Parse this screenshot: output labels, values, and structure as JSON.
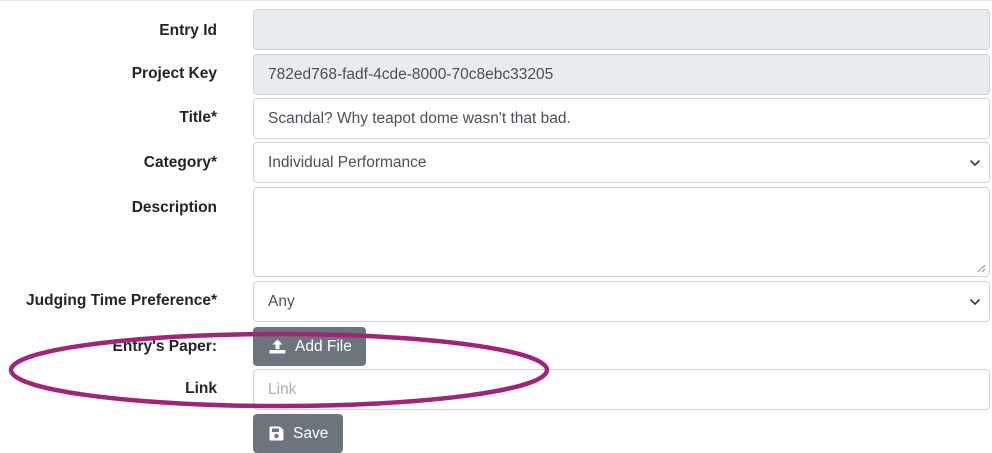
{
  "form": {
    "entry_id": {
      "label": "Entry Id",
      "value": ""
    },
    "project_key": {
      "label": "Project Key",
      "value": "782ed768-fadf-4cde-8000-70c8ebc33205"
    },
    "title": {
      "label": "Title*",
      "value": "Scandal? Why teapot dome wasn't that bad."
    },
    "category": {
      "label": "Category*",
      "selected": "Individual Performance"
    },
    "description": {
      "label": "Description",
      "value": ""
    },
    "judging_time": {
      "label": "Judging Time Preference*",
      "selected": "Any"
    },
    "entry_paper": {
      "label": "Entry's Paper:",
      "button_label": "Add File"
    },
    "link": {
      "label": "Link",
      "placeholder": "Link",
      "value": ""
    },
    "save": {
      "button_label": "Save"
    }
  },
  "colors": {
    "button_bg": "#6c757d",
    "readonly_bg": "#e9ecef",
    "border": "#ced4da",
    "annotation_ellipse": "#a02479"
  }
}
